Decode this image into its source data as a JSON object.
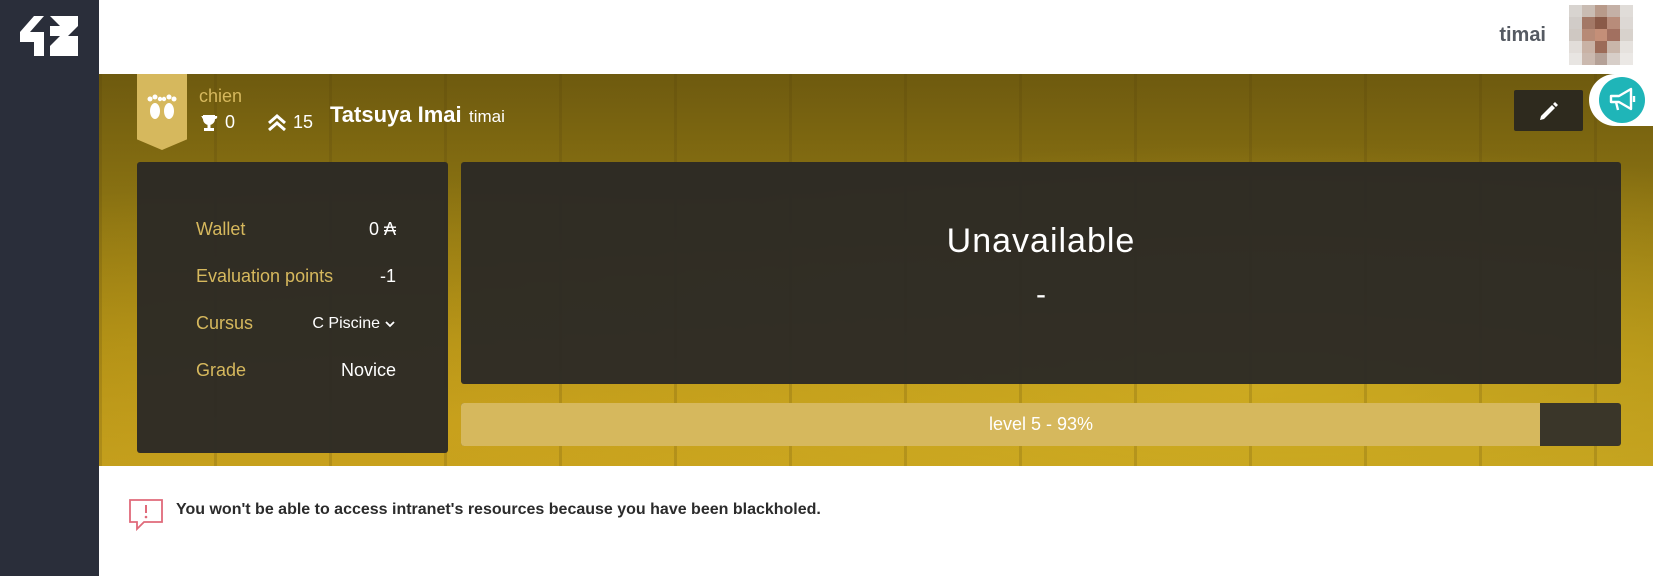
{
  "sidebar": {
    "logo_icon": "42-logo-icon"
  },
  "topbar": {
    "login": "timai",
    "avatar_icon": "user-avatar"
  },
  "profile": {
    "coalition": "chien",
    "coalition_icon": "paw-prints-icon",
    "achievements": "0",
    "rank": "15",
    "display_name": "Tatsuya Imai",
    "username": "timai",
    "accent": "#d6b85d"
  },
  "info": {
    "wallet_label": "Wallet",
    "wallet_value": "0 ₳",
    "eval_label": "Evaluation points",
    "eval_value": "-1",
    "cursus_label": "Cursus",
    "cursus_value": "C Piscine",
    "grade_label": "Grade",
    "grade_value": "Novice"
  },
  "location": {
    "title": "Unavailable",
    "sub": "-"
  },
  "level": {
    "label": "level 5 - 93%",
    "progress": 0.93
  },
  "alert": {
    "text": "You won't be able to access intranet's resources because you have been blackholed.",
    "color": "#e06a7a"
  },
  "announce_color": "#1fb5b8"
}
